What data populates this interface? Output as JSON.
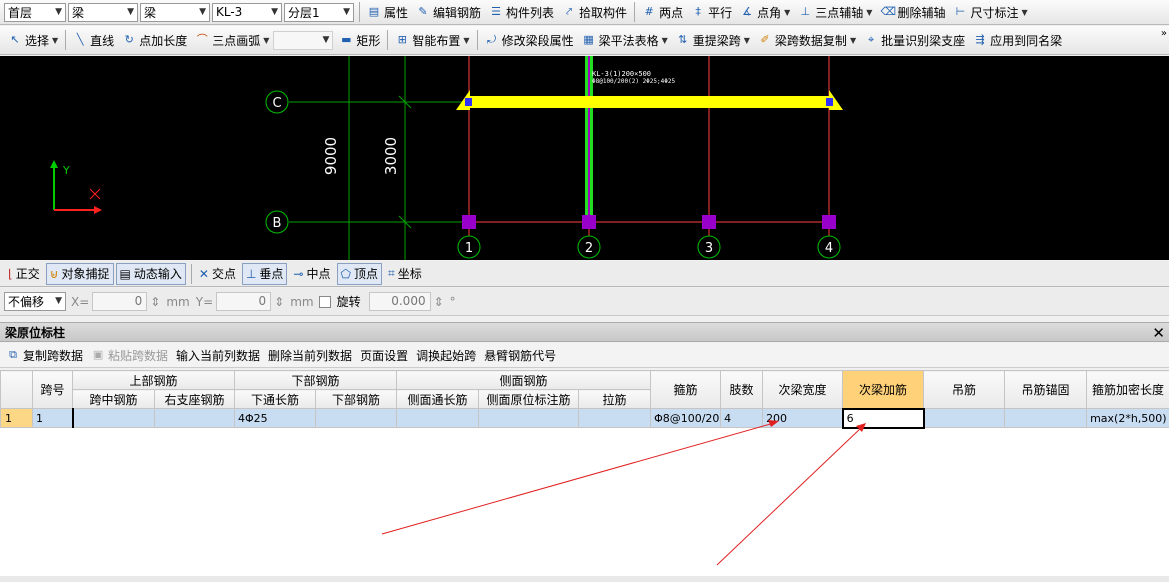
{
  "top_toolbar": {
    "floor": "首层",
    "category": "梁",
    "type": "梁",
    "component": "KL-3",
    "layer": "分层1",
    "properties": "属性",
    "edit_rebar": "编辑钢筋",
    "component_list": "构件列表",
    "pick_component": "拾取构件",
    "two_points": "两点",
    "parallel": "平行",
    "point_angle": "点角",
    "three_point_axis": "三点辅轴",
    "delete_axis": "删除辅轴",
    "dimension": "尺寸标注"
  },
  "draw_toolbar": {
    "select": "选择",
    "line": "直线",
    "point_length": "点加长度",
    "three_point_arc": "三点画弧",
    "rectangle": "矩形",
    "smart_layout": "智能布置",
    "modify_segment": "修改梁段属性",
    "flat_table": "梁平法表格",
    "relift_span": "重提梁跨",
    "span_copy": "梁跨数据复制",
    "batch_identify": "批量识别梁支座",
    "apply_same_name": "应用到同名梁"
  },
  "canvas": {
    "axis_labels": [
      "C",
      "B",
      "1",
      "2",
      "3",
      "4"
    ],
    "dim_9000": "9000",
    "dim_3000": "3000",
    "y_label": "Y",
    "beam_annotation": "KL-3(1)200×500",
    "beam_annotation2": "Φ8@100/200(2) 2Φ25;4Φ25"
  },
  "snap_toolbar": {
    "ortho": "正交",
    "object_snap": "对象捕捉",
    "dynamic_input": "动态输入",
    "intersection": "交点",
    "perpendicular": "垂点",
    "midpoint": "中点",
    "vertex": "顶点",
    "coordinate": "坐标"
  },
  "coord_toolbar": {
    "offset_mode": "不偏移",
    "x_label": "X=",
    "x_value": "0",
    "y_label": "Y=",
    "y_value": "0",
    "unit": "mm",
    "rotate_label": "旋转",
    "rotate_value": "0.000",
    "deg": "°"
  },
  "panel": {
    "title": "梁原位标柱",
    "close": "✕",
    "copy_span": "复制跨数据",
    "paste_span": "粘贴跨数据",
    "input_column": "输入当前列数据",
    "delete_column": "删除当前列数据",
    "page_setup": "页面设置",
    "adjust_start": "调换起始跨",
    "cantilever_code": "悬臂钢筋代号"
  },
  "table": {
    "headers": {
      "span_no": "跨号",
      "top_rebar": "上部钢筋",
      "bottom_rebar": "下部钢筋",
      "side_rebar": "侧面钢筋",
      "stirrup": "箍筋",
      "legs": "肢数",
      "sec_width": "次梁宽度",
      "sec_add": "次梁加筋",
      "hanger": "吊筋",
      "hanger_anchor": "吊筋锚固",
      "dense_length": "箍筋加密长度",
      "mid_span": "跨中钢筋",
      "right_support": "右支座钢筋",
      "bottom_through": "下通长筋",
      "bottom_rebar_sub": "下部钢筋",
      "side_through": "侧面通长筋",
      "side_original": "侧面原位标注筋",
      "tie": "拉筋"
    },
    "rows": [
      {
        "row_num": "1",
        "span": "1",
        "mid_span": "",
        "right_support": "",
        "bottom_through": "4Φ25",
        "bottom": "",
        "side_through": "",
        "side_original": "",
        "tie": "",
        "stirrup": "Φ8@100/20",
        "legs": "4",
        "sec_width": "200",
        "sec_add": "6",
        "hanger": "",
        "hanger_anchor": "",
        "dense_length": "max(2*h,500)"
      }
    ]
  },
  "colors": {
    "beam": "#ffff00",
    "axis": "#ff4040",
    "grid_green": "#00c000",
    "column": "#9900cc",
    "arrow": "#e02020"
  }
}
